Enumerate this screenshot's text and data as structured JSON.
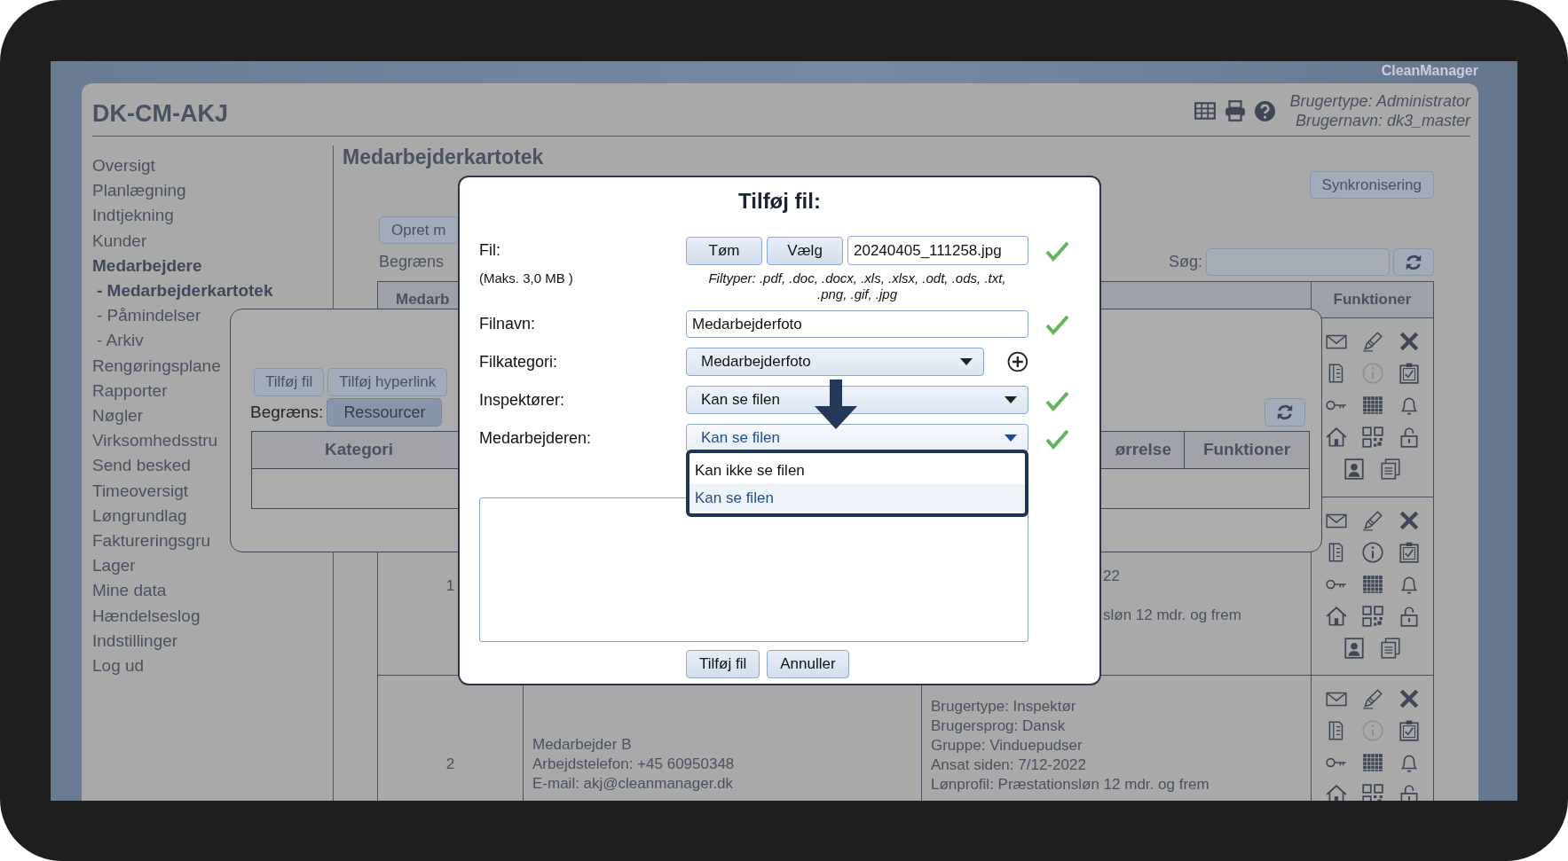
{
  "brand": "CleanManager",
  "header": {
    "title": "DK-CM-AKJ",
    "user_type": "Brugertype: Administrator",
    "user_name": "Brugernavn: dk3_master"
  },
  "sidebar": {
    "items": [
      {
        "label": "Oversigt",
        "selected": false
      },
      {
        "label": "Planlægning",
        "selected": false
      },
      {
        "label": "Indtjekning",
        "selected": false
      },
      {
        "label": "Kunder",
        "selected": false
      },
      {
        "label": "Medarbejdere",
        "selected": true,
        "children": [
          {
            "label": "- Medarbejderkartotek",
            "selected": true
          },
          {
            "label": "- Påmindelser",
            "selected": false
          },
          {
            "label": "- Arkiv",
            "selected": false
          }
        ]
      },
      {
        "label": "Rengøringsplane",
        "selected": false
      },
      {
        "label": "Rapporter",
        "selected": false
      },
      {
        "label": "Nøgler",
        "selected": false
      },
      {
        "label": "Virksomhedsstru",
        "selected": false
      },
      {
        "label": "Send besked",
        "selected": false
      },
      {
        "label": "Timeoversigt",
        "selected": false
      },
      {
        "label": "Løngrundlag",
        "selected": false
      },
      {
        "label": "Faktureringsgru",
        "selected": false
      },
      {
        "label": "Lager",
        "selected": false
      },
      {
        "label": "Mine data",
        "selected": false
      },
      {
        "label": "Hændelseslog",
        "selected": false
      },
      {
        "label": "Indstillinger",
        "selected": false
      },
      {
        "label": "Log ud",
        "selected": false
      }
    ]
  },
  "main": {
    "heading": "Medarbejderkartotek",
    "sync_button": "Synkronisering",
    "create_button": "Opret m",
    "filter_label": "Begræns",
    "search_label": "Søg:",
    "table": {
      "columns": [
        "Medarb",
        "Funktioner"
      ],
      "rows": [
        {
          "kind": "covered",
          "info_enabled": false
        },
        {
          "kind": "partial",
          "number": "1",
          "details": [
            "22",
            "sløn 12 mdr. og frem"
          ],
          "info_enabled": true
        },
        {
          "kind": "full",
          "number": "2",
          "contact": [
            "Medarbejder B",
            "Arbejdstelefon: +45 60950348",
            "E-mail: akj@cleanmanager.dk"
          ],
          "details": [
            "Brugertype: Inspektør",
            "Brugersprog: Dansk",
            "Gruppe: Vinduepudser",
            "Ansat siden: 7/12-2022",
            "Lønprofil: Præstationsløn 12 mdr. og frem"
          ],
          "info_enabled": false
        }
      ]
    }
  },
  "files_dialog": {
    "buttons": [
      "Tilføj fil",
      "Tilføj hyperlink"
    ],
    "filter_label": "Begræns:",
    "filters": [
      {
        "label": "Ressourcer",
        "selected": true
      }
    ],
    "table": {
      "columns": [
        "Kategori",
        "ørrelse",
        "Funktioner"
      ]
    }
  },
  "add_dialog": {
    "title": "Tilføj fil:",
    "fields": [
      {
        "kind": "file",
        "label": "Fil:",
        "buttons": [
          "Tøm",
          "Vælg"
        ],
        "value": "20240405_111258.jpg",
        "valid": true,
        "note": "(Maks. 3,0 MB )",
        "hint": "Filtyper: .pdf, .doc, .docx, .xls, .xlsx, .odt, .ods, .txt, .png, .gif, .jpg"
      },
      {
        "kind": "text",
        "label": "Filnavn:",
        "value": "Medarbejderfoto",
        "valid": true
      },
      {
        "kind": "select",
        "label": "Filkategori:",
        "value": "Medarbejderfoto",
        "valid": false,
        "open": false,
        "addable": true
      },
      {
        "kind": "select",
        "label": "Inspektører:",
        "value": "Kan se filen",
        "valid": true,
        "open": false
      },
      {
        "kind": "select",
        "label": "Medarbejderen:",
        "value": "Kan se filen",
        "valid": true,
        "open": true,
        "options": [
          {
            "label": "Kan ikke se filen",
            "selected": false
          },
          {
            "label": "Kan se filen",
            "selected": true
          }
        ]
      }
    ],
    "buttons": [
      "Tilføj fil",
      "Annuller"
    ]
  }
}
